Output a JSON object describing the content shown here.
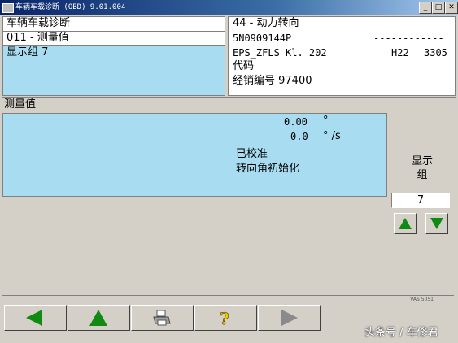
{
  "window": {
    "title": "车辆车载诊断 (OBD)  9.01.004"
  },
  "left_panel": {
    "title": "车辆车载诊断",
    "function": "011 - 测量值",
    "selected_group": "显示组 7"
  },
  "right_panel": {
    "address": "44 - 动力转向",
    "part_number": "5N0909144P",
    "dashes": "------------",
    "component": "EPS_ZFLS Kl. 202",
    "version": "H22",
    "coding_value": "3305",
    "coding_label": "代码",
    "dealer": "经销编号 97400"
  },
  "measured": {
    "header": "测量值",
    "rows": [
      {
        "value": "0.00",
        "unit": "°"
      },
      {
        "value": "0.0",
        "unit": "° /s"
      }
    ],
    "status1": "已校准",
    "status2": "转向角初始化"
  },
  "display_group": {
    "label": "显示\n组",
    "label_line1": "显示",
    "label_line2": "组",
    "value": "7"
  },
  "statusbar": {
    "text": "VAS 5051"
  },
  "toolbar": {
    "icons": [
      "back-arrow-icon",
      "up-arrow-icon",
      "print-icon",
      "help-icon",
      "forward-arrow-icon"
    ]
  },
  "watermark": "头条号 / 车修君",
  "colors": {
    "highlight": "#a8dcf0",
    "arrow_green": "#118a11"
  }
}
